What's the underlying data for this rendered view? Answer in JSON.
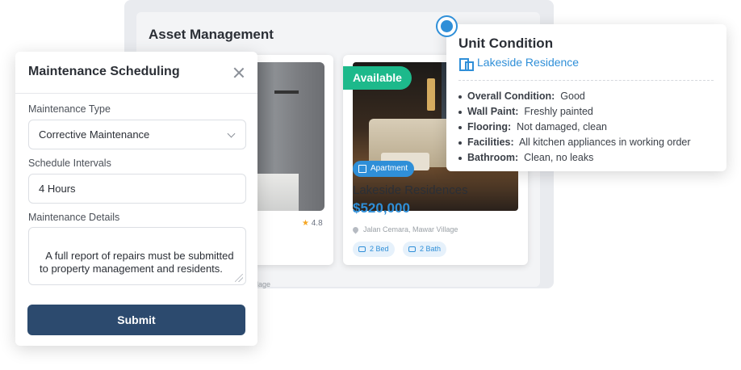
{
  "asset_management": {
    "title": "Asset Management",
    "card_left": {
      "rating": "4.8",
      "location_partial": "llage"
    },
    "card_main": {
      "status_badge": "Available",
      "type_tag": "Apartment",
      "name": "Lakeside Residences",
      "price": "$520,000",
      "location": "Jalan Cemara, Mawar Village",
      "beds": "2 Bed",
      "baths": "2 Bath"
    }
  },
  "unit_condition": {
    "title": "Unit Condition",
    "property": "Lakeside Residence",
    "items": [
      {
        "key": "Overall Condition:",
        "value": "Good"
      },
      {
        "key": "Wall Paint:",
        "value": "Freshly painted"
      },
      {
        "key": "Flooring:",
        "value": "Not damaged, clean"
      },
      {
        "key": "Facilities:",
        "value": "All kitchen appliances in working order"
      },
      {
        "key": "Bathroom:",
        "value": "Clean, no leaks"
      }
    ]
  },
  "maintenance_modal": {
    "title": "Maintenance Scheduling",
    "type_label": "Maintenance Type",
    "type_value": "Corrective Maintenance",
    "interval_label": "Schedule Intervals",
    "interval_value": "4 Hours",
    "details_label": "Maintenance Details",
    "details_value": "A full report of repairs must be submitted to property management and residents.",
    "submit_label": "Submit"
  },
  "colors": {
    "accent": "#2f8fd8",
    "available": "#1db98b",
    "submit": "#2c4a6e"
  }
}
